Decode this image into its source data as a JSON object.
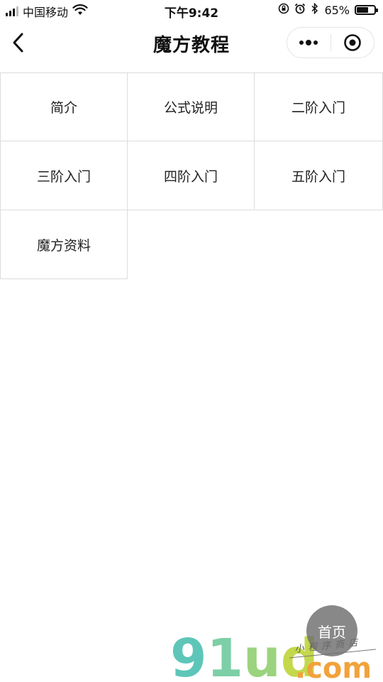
{
  "status_bar": {
    "carrier": "中国移动",
    "time": "下午9:42",
    "battery_percent": "65%",
    "battery_level": 0.65
  },
  "nav": {
    "title": "魔方教程"
  },
  "menu": {
    "items": [
      {
        "label": "简介"
      },
      {
        "label": "公式说明"
      },
      {
        "label": "二阶入门"
      },
      {
        "label": "三阶入门"
      },
      {
        "label": "四阶入门"
      },
      {
        "label": "五阶入门"
      },
      {
        "label": "魔方资料"
      }
    ]
  },
  "home_button": {
    "label": "首页"
  },
  "watermark": {
    "brand": "91ud",
    "domain": ".com",
    "tagline": "小程序商店",
    "colors": {
      "nine": "#5ec6b8",
      "one": "#7ccfa6",
      "u": "#9bd37e",
      "d": "#c4d84b",
      "com": "#f2a23b"
    }
  }
}
